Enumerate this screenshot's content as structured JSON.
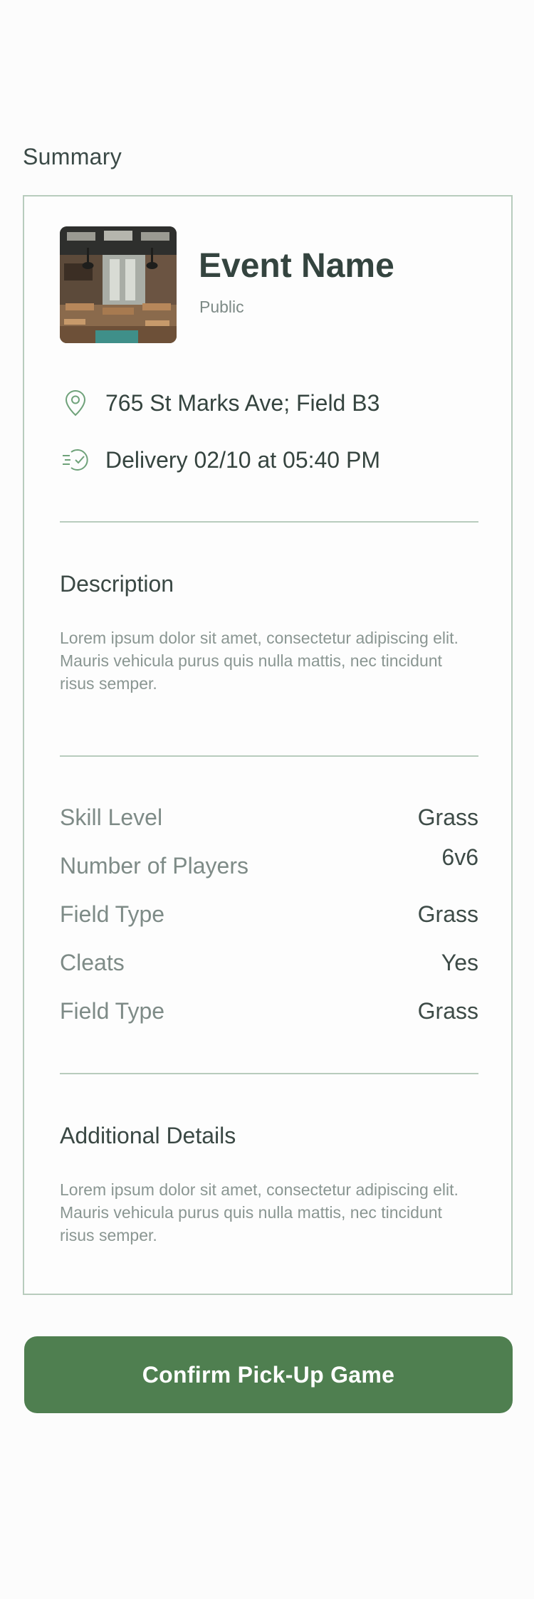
{
  "summary": {
    "heading": "Summary"
  },
  "event": {
    "name": "Event Name",
    "privacy": "Public",
    "image_icon": "restaurant-photo"
  },
  "info": {
    "location": {
      "icon": "map-pin-icon",
      "text": "765 St Marks Ave; Field B3"
    },
    "delivery": {
      "icon": "fast-check-icon",
      "text": "Delivery 02/10 at 05:40 PM"
    }
  },
  "description": {
    "title": "Description",
    "body": "Lorem ipsum dolor sit amet, consectetur adipiscing elit. Mauris vehicula purus quis nulla mattis, nec tincidunt risus semper."
  },
  "details": [
    {
      "label": "Skill Level",
      "value": "Grass"
    },
    {
      "label": "Number of Players",
      "value": "6v6"
    },
    {
      "label": "Field Type",
      "value": "Grass"
    },
    {
      "label": "Cleats",
      "value": "Yes"
    },
    {
      "label": "Field Type",
      "value": "Grass"
    }
  ],
  "additional": {
    "title": "Additional Details",
    "body": "Lorem ipsum dolor sit amet, consectetur adipiscing elit. Mauris vehicula purus quis nulla mattis, nec tincidunt risus semper."
  },
  "actions": {
    "confirm_label": "Confirm Pick-Up Game"
  },
  "colors": {
    "accent": "#4f7f50",
    "border": "#b8ccbd",
    "icon": "#6fa27a"
  }
}
